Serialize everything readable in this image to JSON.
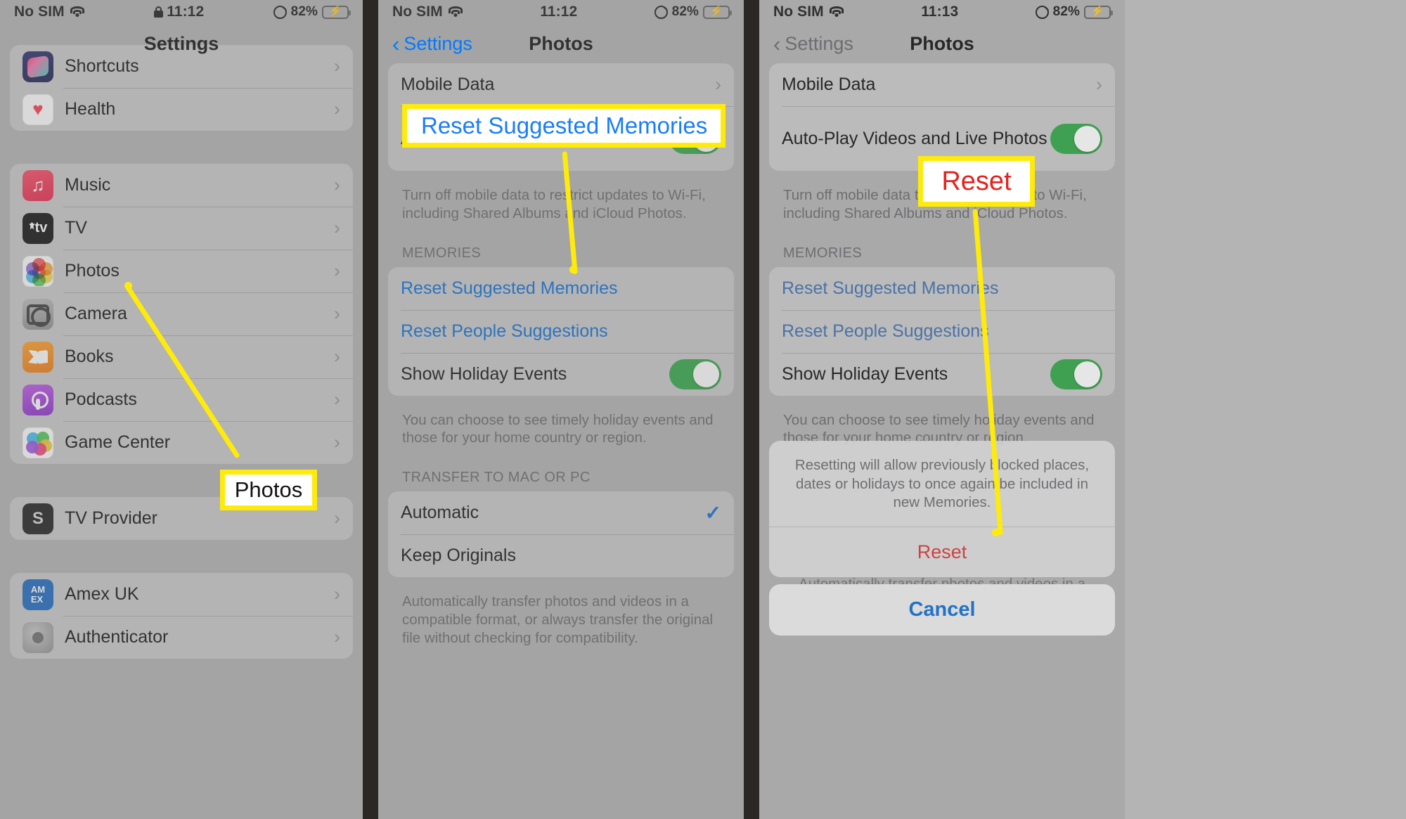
{
  "status_bar": {
    "carrier": "No SIM",
    "wifi_icon": "wifi-icon",
    "time_panel1": "11:12",
    "time_panel2": "11:12",
    "time_panel3": "11:13",
    "lock_icon": "lock-icon",
    "rotation_lock_icon": "rotation-lock-icon",
    "battery_percent": "82%",
    "battery_level": 82,
    "charging": true
  },
  "panel1": {
    "nav_title": "Settings",
    "groups": [
      {
        "rows": [
          {
            "label": "Shortcuts",
            "icon": "shortcuts-app-icon",
            "chevron": "›"
          },
          {
            "label": "Health",
            "icon": "health-app-icon",
            "chevron": "›"
          }
        ]
      },
      {
        "rows": [
          {
            "label": "Music",
            "icon": "music-app-icon",
            "chevron": "›"
          },
          {
            "label": "TV",
            "icon": "tv-app-icon",
            "chevron": "›"
          },
          {
            "label": "Photos",
            "icon": "photos-app-icon",
            "chevron": "›"
          },
          {
            "label": "Camera",
            "icon": "camera-app-icon",
            "chevron": "›"
          },
          {
            "label": "Books",
            "icon": "books-app-icon",
            "chevron": "›"
          },
          {
            "label": "Podcasts",
            "icon": "podcasts-app-icon",
            "chevron": "›"
          },
          {
            "label": "Game Center",
            "icon": "game-center-app-icon",
            "chevron": "›"
          }
        ]
      },
      {
        "rows": [
          {
            "label": "TV Provider",
            "icon": "tv-provider-app-icon",
            "chevron": "›"
          }
        ]
      },
      {
        "rows": [
          {
            "label": "Amex UK",
            "icon": "amex-app-icon",
            "chevron": "›"
          },
          {
            "label": "Authenticator",
            "icon": "authenticator-app-icon",
            "chevron": "›"
          }
        ]
      }
    ],
    "callout": {
      "text": "Photos"
    }
  },
  "panel2": {
    "nav_back": "Settings",
    "nav_back_chevron": "‹",
    "nav_title": "Photos",
    "top_group": [
      {
        "label": "Mobile Data",
        "type": "disclosure",
        "chevron": "›"
      },
      {
        "label": "Auto-Play Videos and Live Photos",
        "type": "toggle",
        "toggle_on": true
      }
    ],
    "top_footer": "Turn off mobile data to restrict updates to Wi-Fi, including Shared Albums and iCloud Photos.",
    "memories_header": "MEMORIES",
    "memories_rows": [
      {
        "label": "Reset Suggested Memories",
        "type": "action"
      },
      {
        "label": "Reset People Suggestions",
        "type": "action"
      },
      {
        "label": "Show Holiday Events",
        "type": "toggle",
        "toggle_on": true
      }
    ],
    "memories_footer": "You can choose to see timely holiday events and those for your home country or region.",
    "transfer_header": "TRANSFER TO MAC OR PC",
    "transfer_rows": [
      {
        "label": "Automatic",
        "checked": true,
        "check": "✓"
      },
      {
        "label": "Keep Originals",
        "checked": false
      }
    ],
    "transfer_footer": "Automatically transfer photos and videos in a compatible format, or always transfer the original file without checking for compatibility.",
    "highlight_label": "Reset Suggested Memories"
  },
  "panel3": {
    "nav_back": "Settings",
    "nav_back_chevron": "‹",
    "nav_title": "Photos",
    "top_group": [
      {
        "label": "Mobile Data",
        "type": "disclosure",
        "chevron": "›"
      },
      {
        "label": "Auto-Play Videos and Live Photos",
        "type": "toggle",
        "toggle_on": true
      }
    ],
    "top_footer": "Turn off mobile data to restrict updates to Wi-Fi, including Shared Albums and iCloud Photos.",
    "memories_header": "MEMORIES",
    "memories_rows": [
      {
        "label": "Reset Suggested Memories",
        "type": "action"
      },
      {
        "label": "Reset People Suggestions",
        "type": "action"
      },
      {
        "label": "Show Holiday Events",
        "type": "toggle",
        "toggle_on": true
      }
    ],
    "memories_footer": "You can choose to see timely holiday events and those for your home country or region.",
    "sheet": {
      "message": "Resetting will allow previously blocked places, dates or holidays to once again be included in new Memories.",
      "reset_label": "Reset",
      "cancel_label": "Cancel"
    },
    "behind_text": "Automatically transfer photos and videos in a",
    "callout": {
      "text": "Reset"
    }
  },
  "colors": {
    "accent_blue": "#0a6ed8",
    "link_blue": "#1a7ef5",
    "destructive_red": "#e03434",
    "toggle_green": "#30a846",
    "annotation_yellow": "#ffeb0a",
    "panel_bg": "#b3b3b3"
  }
}
